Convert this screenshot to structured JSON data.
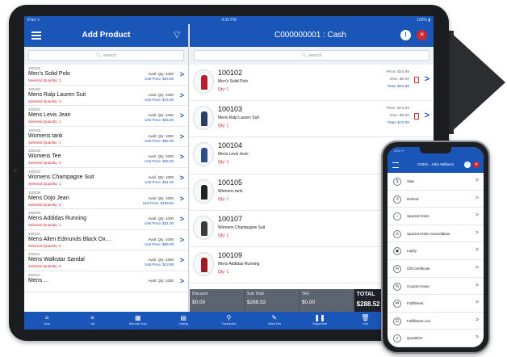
{
  "tablet": {
    "status": {
      "left": "iPad ᯤ",
      "time": "4:33 PM",
      "battery": "100% ▮"
    },
    "left": {
      "title": "Add Product",
      "search_placeholder": "search",
      "products": [
        {
          "code": "100102",
          "name": "Men's Solid Polo",
          "selected": "Selected Quantity: 1",
          "qty": "Avail. Qty: 1000",
          "price": "Unit Price: $24.95"
        },
        {
          "code": "100103",
          "name": "Mens Ralp Lauren Suit",
          "selected": "Selected Quantity: 1",
          "qty": "Avail. Qty: 1000",
          "price": "Unit Price: $72.00"
        },
        {
          "code": "100104",
          "name": "Mens Levis Jean",
          "selected": "Selected Quantity: 1",
          "qty": "Avail. Qty: 1000",
          "price": "Unit Price: $35.00"
        },
        {
          "code": "100105",
          "name": "Womens tank",
          "selected": "Selected Quantity: 1",
          "qty": "Avail. Qty: 1000",
          "price": "Unit Price: $55.00"
        },
        {
          "code": "100106",
          "name": "Womens Tee",
          "selected": "Selected Quantity: 0",
          "qty": "Avail. Qty: 1000",
          "price": "Unit Price: $35.50"
        },
        {
          "code": "100107",
          "name": "Womens Champagne Suit",
          "selected": "Selected Quantity: 1",
          "qty": "Avail. Qty: 1000",
          "price": "Unit Price: $61.00"
        },
        {
          "code": "100108",
          "name": "Mens Dojo Jean",
          "selected": "Selected Quantity: 0",
          "qty": "Avail. Qty: 1000",
          "price": "Unit Price: $189.00"
        },
        {
          "code": "100109",
          "name": "Mens Addidas Running",
          "selected": "Selected Quantity: 1",
          "qty": "Avail. Qty: 1000",
          "price": "Unit Price: $31.00"
        },
        {
          "code": "100110",
          "name": "Mens Allen Edmunds Black Ox…",
          "selected": "Selected Quantity: 0",
          "qty": "Avail. Qty: 1000",
          "price": "Unit Price: $89.00"
        },
        {
          "code": "100111",
          "name": "Mens Walkstar Sandal",
          "selected": "Selected Quantity: 0",
          "qty": "Avail. Qty: 1000",
          "price": "Unit Price: $13.99"
        },
        {
          "code": "100112",
          "name": "Mens ...",
          "selected": "",
          "qty": "Avail. Qty: 1000",
          "price": ""
        }
      ]
    },
    "right": {
      "title": "C000000001 : Cash",
      "search_placeholder": "search",
      "cart": [
        {
          "id": "100102",
          "name": "Men's Solid Polo",
          "qty": "Qty: 1",
          "price": "Price: $24.95",
          "disc": "Disc: $0.00",
          "total": "Total: $24.95",
          "color": "#b8212b"
        },
        {
          "id": "100103",
          "name": "Mens Ralp Lauren Suit",
          "qty": "Qty: 1",
          "price": "Price: $72.00",
          "disc": "Disc: $0.00",
          "total": "Total: $72.00",
          "color": "#2c3e66"
        },
        {
          "id": "100104",
          "name": "Mens Levis Jean",
          "qty": "Qty: 1",
          "price": "Price",
          "disc": "Disc",
          "total": "Tota",
          "color": "#2d4f86"
        },
        {
          "id": "100105",
          "name": "Womens tank",
          "qty": "Qty: 1",
          "price": "Pric",
          "disc": "Disc",
          "total": "Tota",
          "color": "#222222"
        },
        {
          "id": "100107",
          "name": "Womens Champagne Suit",
          "qty": "Qty: 1",
          "price": "Pric",
          "disc": "Disc",
          "total": "Tota",
          "color": "#3a3a3a"
        },
        {
          "id": "100109",
          "name": "Mens Addidas Running",
          "qty": "Qty: 1",
          "price": "Pric",
          "disc": "Disc",
          "total": "Tota",
          "color": "#9b1c22"
        }
      ],
      "totals": {
        "discount_label": "Discount",
        "discount": "$0.00",
        "subtotal_label": "Sub Total",
        "subtotal": "$288.52",
        "tax_label": "TAX",
        "tax": "$0.00",
        "total_label": "TOTAL",
        "total": "$288.52"
      }
    },
    "bottom": [
      "Scan",
      "List",
      "Barcode Scan",
      "Catalog",
      "Transaction",
      "Sales Edit",
      "Suspended",
      "Void",
      "More"
    ]
  },
  "phone": {
    "status": "4:33 ᯤ",
    "title": "C0001 - John Williams",
    "menu": [
      "Sale",
      "Refund",
      "Special Order",
      "Special Order Cancellation",
      "Layby",
      "Gift Certificate",
      "Coupon Issue",
      "Fulfillment",
      "Fulfillment List",
      "Quotation"
    ]
  },
  "colors": {
    "accent": "#1a56b8",
    "alert": "#d0262e"
  }
}
